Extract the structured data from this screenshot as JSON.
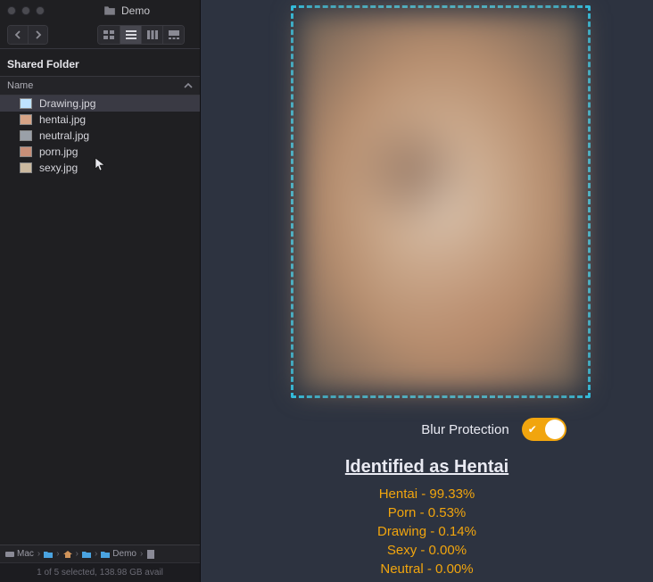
{
  "finder": {
    "title_folder": "Demo",
    "section_title": "Shared Folder",
    "name_header": "Name",
    "files": [
      {
        "name": "Drawing.jpg",
        "selected": true,
        "tint": "#bfe3ff"
      },
      {
        "name": "hentai.jpg",
        "selected": false,
        "tint": "#d6a487"
      },
      {
        "name": "neutral.jpg",
        "selected": false,
        "tint": "#9aa0a8"
      },
      {
        "name": "porn.jpg",
        "selected": false,
        "tint": "#c78f78"
      },
      {
        "name": "sexy.jpg",
        "selected": false,
        "tint": "#cbb9a0"
      }
    ],
    "path": [
      "Mac",
      "",
      "",
      "",
      "Demo",
      ""
    ],
    "status": "1 of 5 selected, 138.98 GB avail"
  },
  "preview": {
    "toggle_label": "Blur Protection",
    "toggle_on": true,
    "result_title": "Identified as Hentai",
    "scores": [
      "Hentai - 99.33%",
      "Porn - 0.53%",
      "Drawing - 0.14%",
      "Sexy - 0.00%",
      "Neutral - 0.00%"
    ],
    "colors": {
      "accent": "#f1a50e",
      "dashed": "#2dc4e8"
    }
  }
}
